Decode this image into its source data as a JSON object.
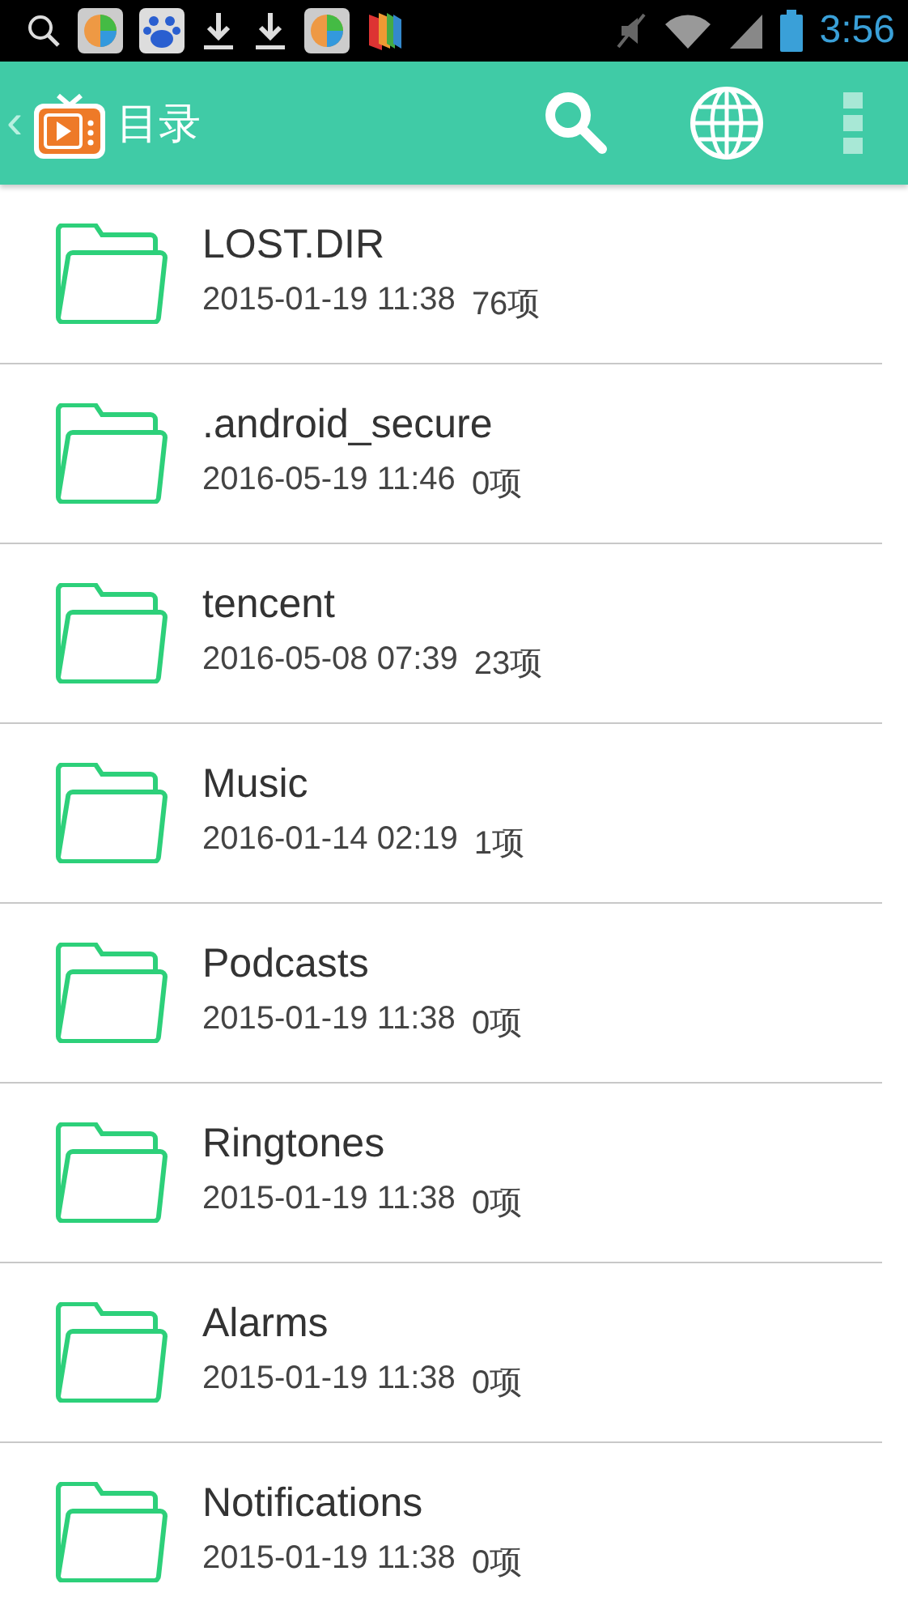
{
  "status_bar": {
    "time": "3:56"
  },
  "app_bar": {
    "back": "‹",
    "title": "目录"
  },
  "folders": [
    {
      "name": "LOST.DIR",
      "date": "2015-01-19 11:38",
      "count": "76项"
    },
    {
      "name": ".android_secure",
      "date": "2016-05-19 11:46",
      "count": "0项"
    },
    {
      "name": "tencent",
      "date": "2016-05-08 07:39",
      "count": "23项"
    },
    {
      "name": "Music",
      "date": "2016-01-14 02:19",
      "count": "1项"
    },
    {
      "name": "Podcasts",
      "date": "2015-01-19 11:38",
      "count": "0项"
    },
    {
      "name": "Ringtones",
      "date": "2015-01-19 11:38",
      "count": "0项"
    },
    {
      "name": "Alarms",
      "date": "2015-01-19 11:38",
      "count": "0项"
    },
    {
      "name": "Notifications",
      "date": "2015-01-19 11:38",
      "count": "0项"
    }
  ]
}
